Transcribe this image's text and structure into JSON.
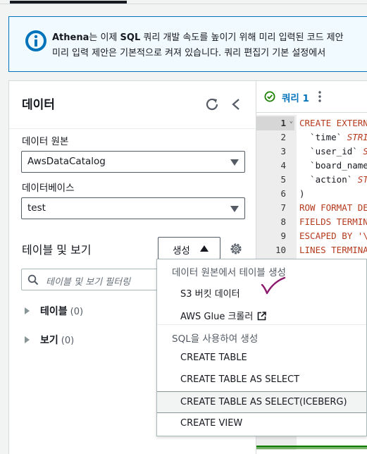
{
  "banner": {
    "product": "Athena",
    "line1_part_a": "는 이제 ",
    "line1_sql": "SQL",
    "line1_part_b": " 쿼리 개발 속도를 높이기 위해 미리 입력된 코드 제안",
    "line2": "미리 입력 제안은 기본적으로 켜져 있습니다. 쿼리 편집기 기본 설정에서"
  },
  "data_panel": {
    "title": "데이터",
    "data_source_label": "데이터 원본",
    "data_source_value": "AwsDataCatalog",
    "database_label": "데이터베이스",
    "database_value": "test",
    "tables_title": "테이블 및 보기",
    "create_button": "생성",
    "filter_placeholder": "테이블 및 보기 필터링",
    "tree": [
      {
        "label": "테이블",
        "count": "(0)"
      },
      {
        "label": "보기",
        "count": "(0)"
      }
    ]
  },
  "editor": {
    "tab_label": "쿼리 1",
    "line_numbers": [
      "1",
      "2",
      "3",
      "4",
      "5",
      "6",
      "7",
      "8",
      "9",
      "10"
    ],
    "code": [
      [
        {
          "t": "CREATE EXTERN",
          "c": "kw"
        }
      ],
      [
        {
          "t": "  `time` ",
          "c": ""
        },
        {
          "t": "STRI",
          "c": "ty"
        }
      ],
      [
        {
          "t": "  `user_id` ",
          "c": ""
        },
        {
          "t": "S",
          "c": "ty"
        }
      ],
      [
        {
          "t": "  `board_name",
          "c": ""
        }
      ],
      [
        {
          "t": "  `action` ",
          "c": ""
        },
        {
          "t": "ST",
          "c": "ty"
        }
      ],
      [
        {
          "t": ")",
          "c": ""
        }
      ],
      [
        {
          "t": "ROW FORMAT DE",
          "c": "kw"
        }
      ],
      [
        {
          "t": "FIELDS TERMIN",
          "c": "kw"
        }
      ],
      [
        {
          "t": "ESCAPED BY '\\",
          "c": "kw"
        }
      ],
      [
        {
          "t": "LINES TERMINA",
          "c": "kw"
        }
      ]
    ]
  },
  "create_menu": {
    "group1_header": "데이터 원본에서 테이블 생성",
    "group1_items": [
      "S3 버킷 데이터",
      "AWS Glue 크롤러"
    ],
    "group2_header": "SQL을 사용하여 생성",
    "group2_items": [
      "CREATE TABLE",
      "CREATE TABLE AS SELECT",
      "CREATE TABLE AS SELECT(ICEBERG)",
      "CREATE VIEW"
    ]
  },
  "colors": {
    "accent": "#0073bb",
    "keyword": "#b53a1e",
    "success": "#1d8102",
    "annotation": "#8e1a6e"
  },
  "icons": [
    "info-icon",
    "refresh-icon",
    "chevron-left-icon",
    "caret-down-icon",
    "caret-up-icon",
    "gear-icon",
    "search-icon",
    "expand-triangle-icon",
    "success-check-icon",
    "kebab-icon",
    "external-link-icon"
  ]
}
